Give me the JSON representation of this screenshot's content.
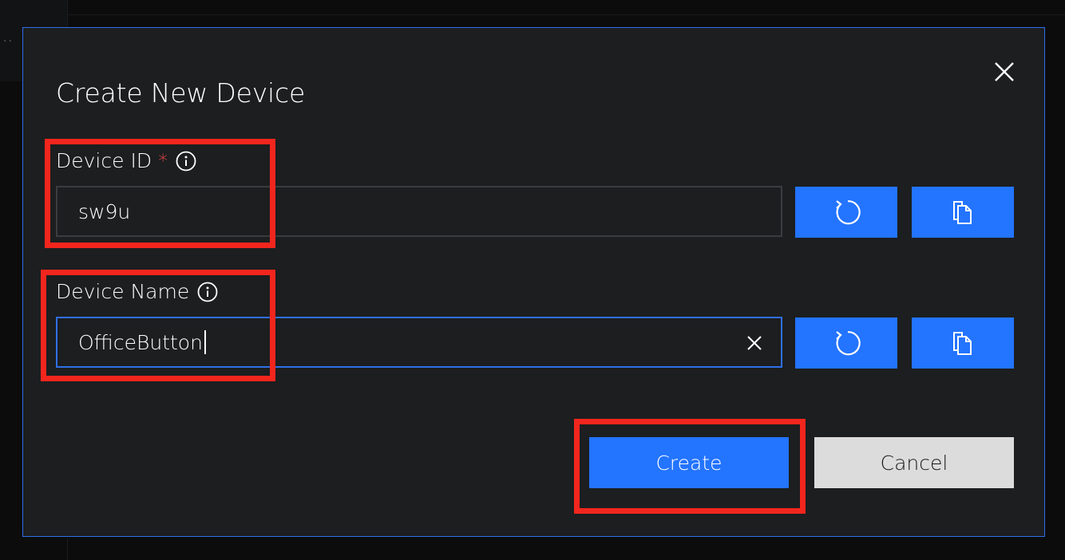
{
  "dialog": {
    "title": "Create New Device",
    "close_icon": "close-icon"
  },
  "device_id": {
    "label": "Device ID",
    "required_marker": "*",
    "info_icon": "info-icon",
    "value": "sw9u",
    "regenerate_icon": "refresh-icon",
    "copy_icon": "copy-icon"
  },
  "device_name": {
    "label": "Device Name",
    "info_icon": "info-icon",
    "value": "OfficeButton",
    "clear_icon": "close-icon",
    "regenerate_icon": "refresh-icon",
    "copy_icon": "copy-icon"
  },
  "actions": {
    "create_label": "Create",
    "cancel_label": "Cancel"
  },
  "colors": {
    "accent": "#2374ff",
    "dialog_border": "#2f6fe8",
    "dialog_bg": "#1c1e20",
    "highlight": "#f2261d",
    "required": "#ff4b4b",
    "cancel_bg": "#dcdcdc"
  }
}
